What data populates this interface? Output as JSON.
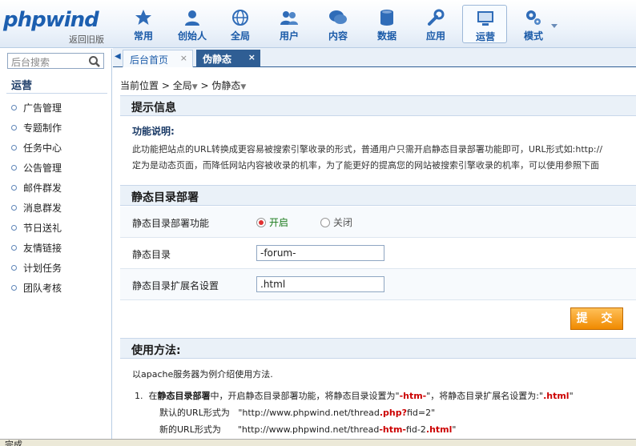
{
  "header": {
    "logo": "phpwind",
    "logo_sub": "返回旧版",
    "nav": [
      {
        "label": "常用",
        "icon": "star-icon"
      },
      {
        "label": "创始人",
        "icon": "user-icon"
      },
      {
        "label": "全局",
        "icon": "globe-icon"
      },
      {
        "label": "用户",
        "icon": "users-icon"
      },
      {
        "label": "内容",
        "icon": "chat-icon"
      },
      {
        "label": "数据",
        "icon": "database-icon"
      },
      {
        "label": "应用",
        "icon": "wrench-icon"
      },
      {
        "label": "运营",
        "icon": "monitor-icon"
      },
      {
        "label": "模式",
        "icon": "gears-icon"
      }
    ],
    "active_nav": "运营"
  },
  "sidebar": {
    "search_placeholder": "后台搜索",
    "title": "运营",
    "items": [
      "广告管理",
      "专题制作",
      "任务中心",
      "公告管理",
      "邮件群发",
      "消息群发",
      "节日送礼",
      "友情链接",
      "计划任务",
      "团队考核"
    ]
  },
  "tabs": [
    {
      "label": "后台首页",
      "close": "×"
    },
    {
      "label": "伪静态",
      "close": "×"
    }
  ],
  "breadcrumb": {
    "prefix": "当前位置",
    "sep": ">",
    "level1": "全局",
    "level2": "伪静态"
  },
  "tips": {
    "heading": "提示信息",
    "func_title": "功能说明:",
    "line1": "此功能把站点的URL转换成更容易被搜索引擎收录的形式，普通用户只需开启静态目录部署功能即可，URL形式如:http://",
    "line2": "定为是动态页面，而降低网站内容被收录的机率，为了能更好的提高您的网站被搜索引擎收录的机率，可以使用参照下面"
  },
  "deploy": {
    "heading": "静态目录部署",
    "function_label": "静态目录部署功能",
    "option_on": "开启",
    "option_off": "关闭",
    "selected": "开启",
    "dir_label": "静态目录",
    "dir_value": "-forum-",
    "ext_label": "静态目录扩展名设置",
    "ext_value": ".html"
  },
  "submit_label": "提 交",
  "usage": {
    "heading": "使用方法:",
    "intro": "以apache服务器为例介绍使用方法.",
    "num": "1.",
    "s1": "在",
    "s2": "静态目录部署",
    "s3": "中，开启静态目录部署功能，将静态目录设置为\"",
    "s4": "-htm-",
    "s5": "\"，将静态目录扩展名设置为:\"",
    "s6": ".html",
    "s7": "\"",
    "d_label": "默认的URL形式为",
    "d1": "\"http://www.phpwind.net/thread",
    "d2": ".php?",
    "d3": "fid=2\"",
    "n_label": "新的URL形式为",
    "n1": "\"http://www.phpwind.net/thread",
    "n2": "-htm-",
    "n3": "fid-2",
    "n4": ".html",
    "n5": "\""
  },
  "status": "完成",
  "colors": {
    "accent": "#1a5aa8",
    "active_tab": "#2f5e94",
    "submit": "#f08a00",
    "highlight": "#cc0000"
  }
}
